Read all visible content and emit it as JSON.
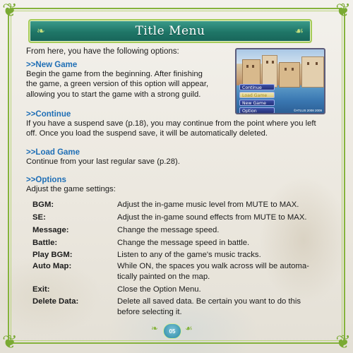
{
  "banner": {
    "title": "Title Menu"
  },
  "intro": "From here, you have the following options:",
  "sections": {
    "new_game": {
      "heading": ">>New Game",
      "lines": [
        "Begin the game from the beginning. After finishing",
        "the game, a green version of this option will appear,",
        "allowing you to start the game with a strong guild."
      ]
    },
    "continue": {
      "heading": ">>Continue",
      "lines": [
        "If you have a suspend save (p.18), you may continue from the point where you left",
        "off. Once you load the suspend save, it will be automatically deleted."
      ]
    },
    "load_game": {
      "heading": ">>Load Game",
      "lines": [
        "Continue from your last regular save (p.28)."
      ]
    },
    "options": {
      "heading": ">>Options",
      "lines": [
        "Adjust the game settings:"
      ]
    }
  },
  "option_rows": [
    {
      "label": "BGM:",
      "desc": [
        "Adjust the in-game music level from MUTE to MAX."
      ]
    },
    {
      "label": "SE:",
      "desc": [
        "Adjust the in-game sound effects from MUTE to MAX."
      ]
    },
    {
      "label": "Message:",
      "desc": [
        "Change the message speed."
      ]
    },
    {
      "label": "Battle:",
      "desc": [
        "Change the message speed in battle."
      ]
    },
    {
      "label": "Play BGM:",
      "desc": [
        "Listen to any of the game's music tracks."
      ]
    },
    {
      "label": "Auto Map:",
      "desc": [
        "While ON, the spaces you walk across will be automa-",
        "tically painted on the map."
      ]
    },
    {
      "label": "Exit:",
      "desc": [
        "Close the Option Menu."
      ]
    },
    {
      "label": "Delete Data:",
      "desc": [
        "Delete all saved data. Be certain you want to do this",
        "before selecting it."
      ]
    }
  ],
  "thumbnail": {
    "menu": [
      "Continue",
      "Load Game",
      "New Game",
      "Option"
    ],
    "selected_index": 1,
    "copyright": "©ATLUS 2008 2009"
  },
  "page_number": "05",
  "colors": {
    "frame": "#86b33d",
    "banner": "#1f7667",
    "heading": "#1f6fb6"
  }
}
